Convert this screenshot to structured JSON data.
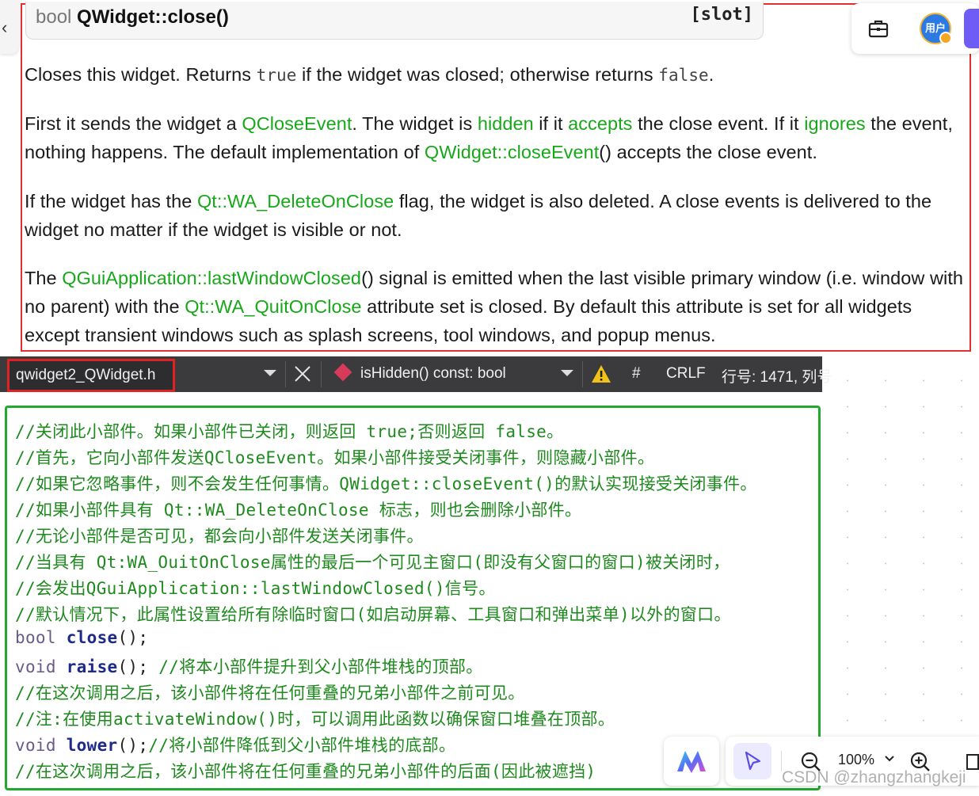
{
  "doc": {
    "signature": {
      "return_type": "bool",
      "name": "QWidget::close()",
      "tag": "[slot]"
    },
    "p1": {
      "a": "Closes this widget. Returns ",
      "true": "true",
      "b": " if the widget was closed; otherwise returns ",
      "false": "false",
      "c": "."
    },
    "p2": {
      "a": "First it sends the widget a ",
      "link1": "QCloseEvent",
      "b": ". The widget is ",
      "link2": "hidden",
      "c": " if it ",
      "link3": "accepts",
      "d": " the close event. If it ",
      "link4": "ignores",
      "e": " the event, nothing happens. The default implementation of ",
      "link5": "QWidget::closeEvent",
      "f": "() accepts the close event."
    },
    "p3": {
      "a": "If the widget has the ",
      "link1": "Qt::WA_DeleteOnClose",
      "b": " flag, the widget is also deleted. A close events is delivered to the widget no matter if the widget is visible or not."
    },
    "p4": {
      "a": "The ",
      "link1": "QGuiApplication::lastWindowClosed",
      "b": "() signal is emitted when the last visible primary window (i.e. window with no parent) with the ",
      "link2": "Qt::WA_QuitOnClose",
      "c": " attribute set is closed. By default this attribute is set for all widgets except transient windows such as splash screens, tool windows, and popup menus."
    }
  },
  "top_right": {
    "avatar_label": "用户"
  },
  "vs_toolbar": {
    "file_tab": "qwidget2_QWidget.h",
    "member": "isHidden() const: bool",
    "hash": "#",
    "line_ending": "CRLF",
    "position": "行号: 1471, 列号"
  },
  "code": {
    "l1": "//关闭此小部件。如果小部件已关闭，则返回 true;否则返回 false。",
    "l2": "//首先，它向小部件发送QCloseEvent。如果小部件接受关闭事件，则隐藏小部件。",
    "l3": "//如果它忽略事件，则不会发生任何事情。QWidget::closeEvent()的默认实现接受关闭事件。",
    "l4": "//如果小部件具有 Qt::WA_DeleteOnClose 标志，则也会删除小部件。",
    "l5": "//无论小部件是否可见，都会向小部件发送关闭事件。",
    "l6": "//当具有 Qt:WA_OuitOnClose属性的最后一个可见主窗口(即没有父窗口的窗口)被关闭时，",
    "l7": "//会发出QGuiApplication::lastWindowClosed()信号。",
    "l8": "//默认情况下，此属性设置给所有除临时窗口(如启动屏幕、工具窗口和弹出菜单)以外的窗口。",
    "l9": {
      "type": "bool",
      "name": "close",
      "rest": "();"
    },
    "l10": {
      "type": "void",
      "name": "raise",
      "rest": "(); ",
      "comment": "//将本小部件提升到父小部件堆栈的顶部。"
    },
    "l11": "//在这次调用之后，该小部件将在任何重叠的兄弟小部件之前可见。",
    "l12": "//注:在使用activateWindow()时，可以调用此函数以确保窗口堆叠在顶部。",
    "l13": {
      "type": "void",
      "name": "lower",
      "rest": "();",
      "comment": "//将小部件降低到父小部件堆栈的底部。"
    },
    "l14": "//在这次调用之后，该小部件将在任何重叠的兄弟小部件的后面(因此被遮挡)"
  },
  "zoom": {
    "value": "100%"
  },
  "watermark": "CSDN @zhangzhangkeji",
  "colors": {
    "link": "#17a81a",
    "doc_border": "#e03030",
    "code_border": "#22aa2e",
    "comment": "#1e8a1e",
    "accent": "#6d5cf5"
  }
}
